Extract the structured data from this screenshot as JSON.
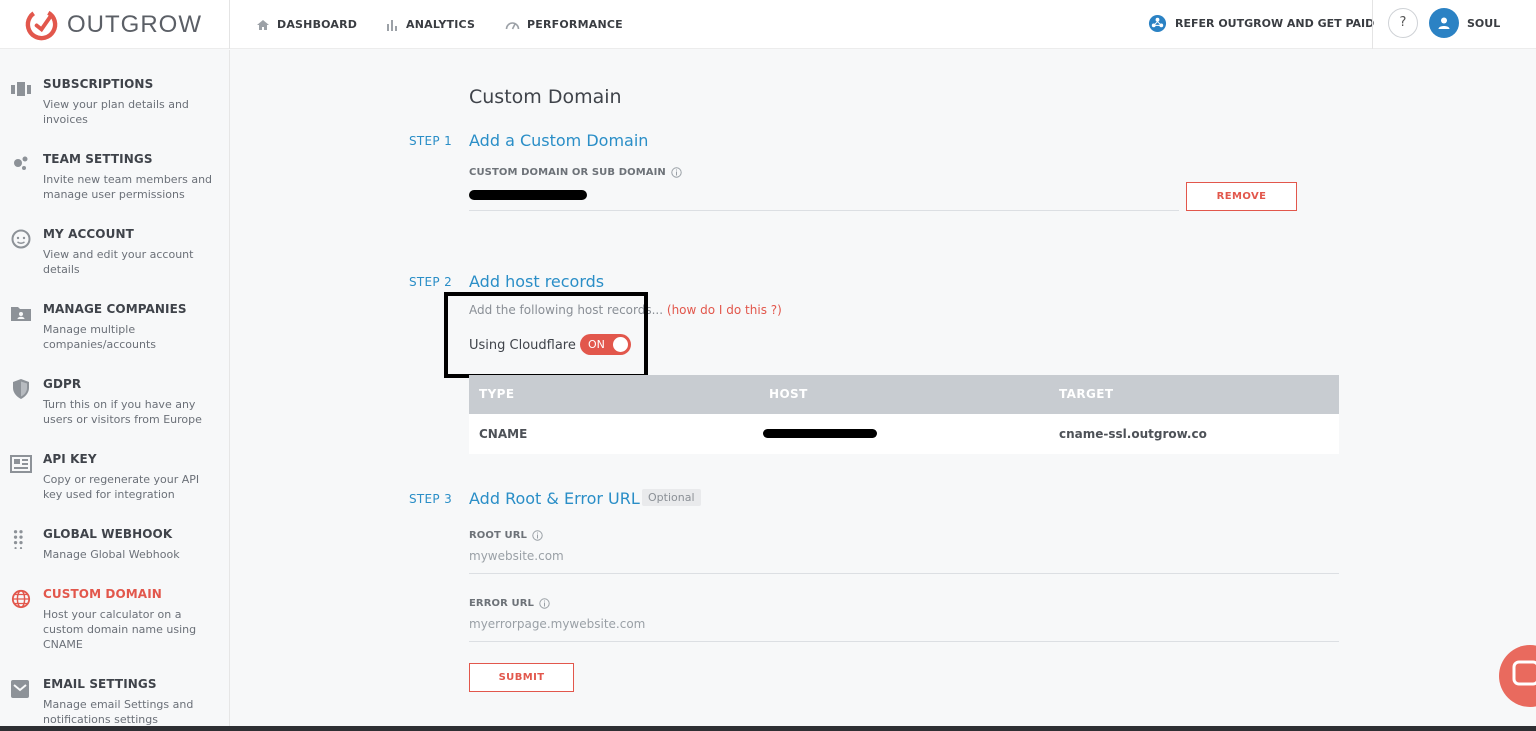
{
  "brand": {
    "name": "OUTGROW",
    "accent": "#e2574c",
    "link_blue": "#2a8ec7"
  },
  "nav": {
    "dashboard": "DASHBOARD",
    "analytics": "ANALYTICS",
    "performance": "PERFORMANCE",
    "refer": "REFER OUTGROW AND GET PAID",
    "help": "?",
    "user": "SOUL"
  },
  "sidebar": {
    "items": [
      {
        "title": "SUBSCRIPTIONS",
        "desc": "View your plan details and invoices",
        "icon": "subscriptions-icon"
      },
      {
        "title": "TEAM SETTINGS",
        "desc": "Invite new team members and manage user permissions",
        "icon": "team-icon"
      },
      {
        "title": "MY ACCOUNT",
        "desc": "View and edit your account details",
        "icon": "account-icon"
      },
      {
        "title": "MANAGE COMPANIES",
        "desc": "Manage multiple companies/accounts",
        "icon": "companies-folder-icon"
      },
      {
        "title": "GDPR",
        "desc": "Turn this on if you have any users or visitors from Europe",
        "icon": "shield-icon"
      },
      {
        "title": "API KEY",
        "desc": "Copy or regenerate your API key used for integration",
        "icon": "api-key-icon"
      },
      {
        "title": "GLOBAL WEBHOOK",
        "desc": "Manage Global Webhook",
        "icon": "webhook-grid-icon"
      },
      {
        "title": "CUSTOM DOMAIN",
        "desc": "Host your calculator on a custom domain name using CNAME",
        "icon": "globe-icon",
        "active": true
      },
      {
        "title": "EMAIL SETTINGS",
        "desc": "Manage email Settings and notifications settings",
        "icon": "email-icon"
      }
    ]
  },
  "main": {
    "title": "Custom Domain",
    "step1": {
      "label": "STEP 1",
      "title": "Add a Custom Domain",
      "field_label": "CUSTOM DOMAIN OR SUB DOMAIN",
      "remove": "REMOVE"
    },
    "step2": {
      "label": "STEP 2",
      "title": "Add host records",
      "hint": "Add the following host records...",
      "hint_link": "(how do I do this ?)",
      "cloudflare_label": "Using Cloudflare",
      "toggle": "ON",
      "table": {
        "headers": [
          "TYPE",
          "HOST",
          "TARGET"
        ],
        "rows": [
          {
            "type": "CNAME",
            "target": "cname-ssl.outgrow.co"
          }
        ]
      }
    },
    "step3": {
      "label": "STEP 3",
      "title": "Add Root & Error URL",
      "badge": "Optional",
      "root_label": "ROOT URL",
      "root_placeholder": "mywebsite.com",
      "error_label": "ERROR URL",
      "error_placeholder": "myerrorpage.mywebsite.com",
      "submit": "SUBMIT"
    }
  }
}
